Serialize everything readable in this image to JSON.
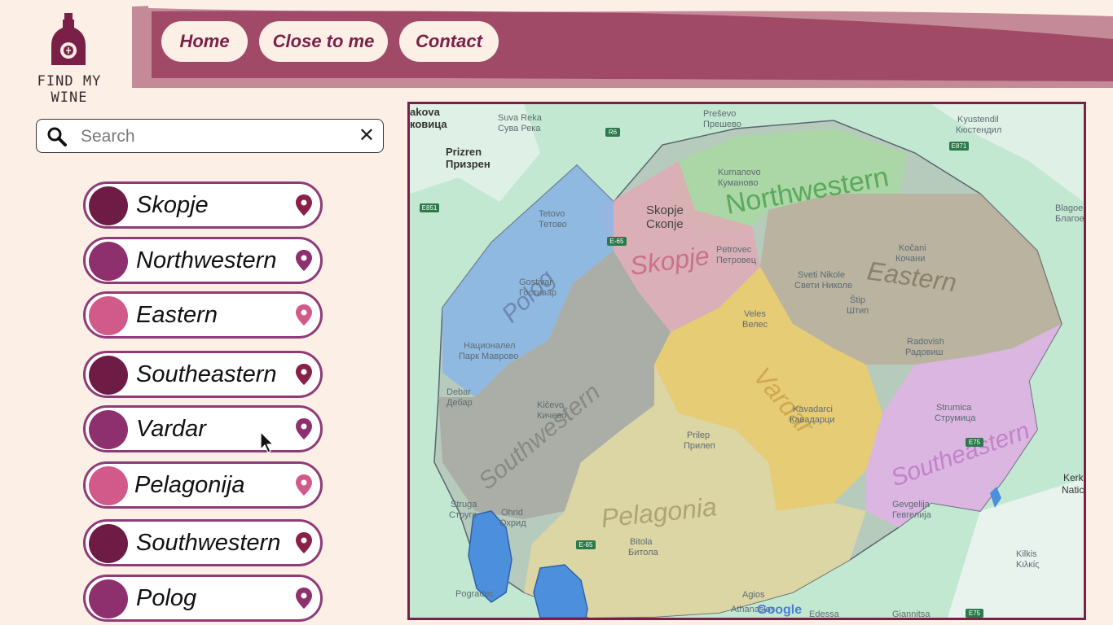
{
  "brand": {
    "name": "FIND MY WINE"
  },
  "nav": {
    "home": "Home",
    "close": "Close to me",
    "contact": "Contact"
  },
  "search": {
    "placeholder": "Search",
    "clear": "✕"
  },
  "colors": {
    "dark": "#6e1c45",
    "mid": "#8e2f6e",
    "light": "#d15a8a",
    "header": "#a04a68"
  },
  "regions": [
    {
      "label": "Skopje",
      "color": "#6e1c45"
    },
    {
      "label": "Northwestern",
      "color": "#8e2f6e"
    },
    {
      "label": "Eastern",
      "color": "#d15a8a"
    },
    {
      "label": "Southeastern",
      "color": "#6e1c45"
    },
    {
      "label": "Vardar",
      "color": "#8e2f6e"
    },
    {
      "label": "Pelagonija",
      "color": "#d15a8a"
    },
    {
      "label": "Southwestern",
      "color": "#6e1c45"
    },
    {
      "label": "Polog",
      "color": "#8e2f6e"
    }
  ],
  "map": {
    "regions": {
      "northwestern": "Northwestern",
      "skopje": "Skopje",
      "eastern": "Eastern",
      "polog": "Polog",
      "vardar": "Vardar",
      "southwestern": "Southwestern",
      "southeastern": "Southeastern",
      "pelagonia": "Pelagonia"
    },
    "places": {
      "kova": "akova",
      "kovica": "ковица",
      "suva1": "Suva Reka",
      "suva2": "Сува Река",
      "presevo1": "Preševo",
      "presevo2": "Прешево",
      "prizren1": "Prizren",
      "prizren2": "Призрен",
      "kyust1": "Kyustendil",
      "kyust2": "Кюстендил",
      "kumanovo1": "Kumanovo",
      "kumanovo2": "Куманово",
      "tetovo1": "Tetovo",
      "tetovo2": "Тетово",
      "skopje1": "Skopje",
      "skopje2": "Скопје",
      "petrovec1": "Petrovec",
      "petrovec2": "Петровец",
      "gostivar1": "Gostivar",
      "gostivar2": "Гостивар",
      "kocani1": "Kočani",
      "kocani2": "Кочани",
      "sveti1": "Sveti Nikole",
      "sveti2": "Свети Николе",
      "stip1": "Štip",
      "stip2": "Штип",
      "veles1": "Veles",
      "veles2": "Велес",
      "nat1": "Националел",
      "nat2": "Парк Маврово",
      "radovish1": "Radovish",
      "radovish2": "Радовиш",
      "debar1": "Debar",
      "debar2": "Дебар",
      "kicevo1": "Kičevo",
      "kicevo2": "Кичево",
      "kavadarci1": "Kavadarci",
      "kavadarci2": "Кавадарци",
      "strumica1": "Strumica",
      "strumica2": "Струмица",
      "prilep1": "Prilep",
      "prilep2": "Прилеп",
      "struga1": "Struga",
      "struga2": "Струга",
      "ohrid1": "Ohrid",
      "ohrid2": "Охрид",
      "gevgelija1": "Gevgelija",
      "gevgelija2": "Гевгелија",
      "bitola1": "Bitola",
      "bitola2": "Битола",
      "kilkis1": "Kilkis",
      "kilkis2": "Κιλκίς",
      "pogradec": "Pogradec",
      "agios1": "Agios",
      "agios2": "Athanasios",
      "edessa": "Edessa",
      "giannitsa": "Giannitsa",
      "blagoe1": "Blagoe",
      "blagoe2": "Благое",
      "kerk1": "Kerk",
      "kerk2": "Natic",
      "google": "Google"
    },
    "roads": {
      "r6": "R6",
      "e871": "E871",
      "e851": "E851",
      "e65a": "E-65",
      "e65b": "E-65",
      "e75a": "E75",
      "e75b": "E75"
    }
  }
}
